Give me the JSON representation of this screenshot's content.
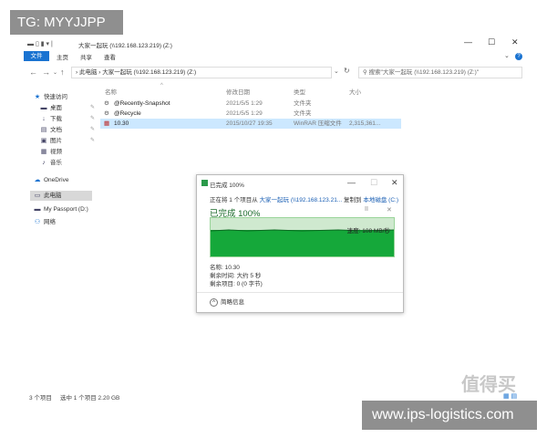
{
  "watermark_top": "TG: MYYJJPP",
  "watermark_bottom": "www.ips-logistics.com",
  "watermark_logo": "值得买",
  "window": {
    "title": "大家一起玩 (\\\\192.168.123.219) (Z:)",
    "minimize": "—",
    "maximize": "☐",
    "close": "✕"
  },
  "ribbon": {
    "file": "文件",
    "tabs": [
      "主页",
      "共享",
      "查看"
    ],
    "help": "?"
  },
  "nav": {
    "back": "←",
    "forward": "→",
    "up": "↑",
    "refresh": "↻",
    "address": "› 此电脑 › 大家一起玩 (\\\\192.168.123.219) (Z:)",
    "search_placeholder": "搜索\"大家一起玩 (\\\\192.168.123.219) (Z:)\""
  },
  "sidebar": [
    {
      "label": "快速访问",
      "icon": "★"
    },
    {
      "label": "桌面",
      "icon": "▬"
    },
    {
      "label": "下载",
      "icon": "↓"
    },
    {
      "label": "文档",
      "icon": "▤"
    },
    {
      "label": "图片",
      "icon": "▣"
    },
    {
      "label": "视频",
      "icon": "▦"
    },
    {
      "label": "音乐",
      "icon": "♪"
    },
    {
      "label": "OneDrive",
      "icon": "☁"
    },
    {
      "label": "此电脑",
      "icon": "▭"
    },
    {
      "label": "My Passport (D:)",
      "icon": "▬"
    },
    {
      "label": "网络",
      "icon": "⚇"
    }
  ],
  "columns": [
    "名称",
    "修改日期",
    "类型",
    "大小"
  ],
  "files": [
    {
      "name": "@Recently-Snapshot",
      "date": "2021/5/5 1:29",
      "type": "文件夹",
      "size": "",
      "icon": "⚙"
    },
    {
      "name": "@Recycle",
      "date": "2021/5/5 1:29",
      "type": "文件夹",
      "size": "",
      "icon": "⚙"
    },
    {
      "name": "10.30",
      "date": "2015/10/27 19:35",
      "type": "WinRAR 压缩文件",
      "size": "2,315,361...",
      "icon": "▦"
    }
  ],
  "status": {
    "count": "3 个项目",
    "selected": "选中 1 个项目  2.20 GB"
  },
  "dialog": {
    "title": "已完成 100%",
    "copy_prefix": "正在将 1 个项目从 ",
    "source": "大家一起玩 (\\\\192.168.123.21...",
    "copy_mid": " 复制到 ",
    "dest": "本地磁盘 (C:)",
    "heading": "已完成 100%",
    "pause": "II",
    "cancel": "✕",
    "speed": "速度: 108 MB/秒",
    "name": "名称: 10.30",
    "remaining_time": "剩余时间: 大约 5 秒",
    "remaining_items": "剩余项目: 0 (0 字节)",
    "less_info": "简略信息",
    "progress": 1.0
  }
}
